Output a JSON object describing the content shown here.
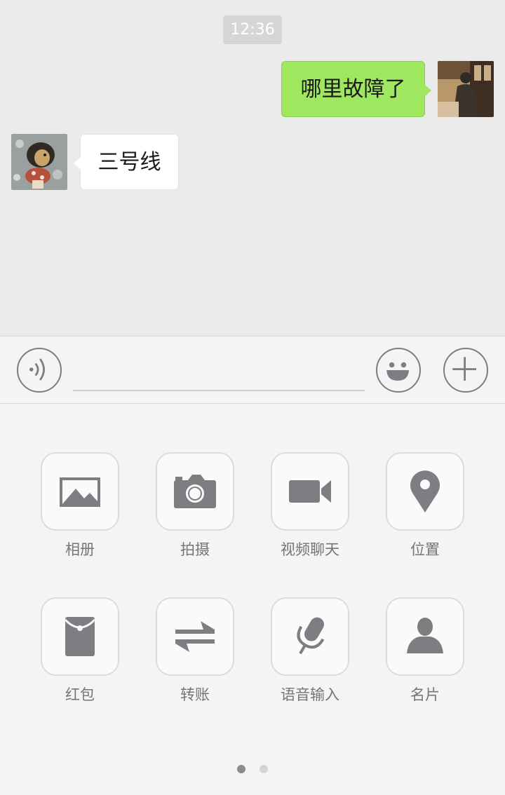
{
  "chat": {
    "timestamp": "12:36",
    "messages": [
      {
        "side": "right",
        "text": "哪里故障了"
      },
      {
        "side": "left",
        "text": "三号线"
      }
    ]
  },
  "input_bar": {
    "icons": [
      "voice-icon",
      "emoji-icon",
      "plus-icon"
    ],
    "text_value": ""
  },
  "panel": {
    "items": [
      {
        "label": "相册",
        "icon": "photo-album-icon"
      },
      {
        "label": "拍摄",
        "icon": "camera-icon"
      },
      {
        "label": "视频聊天",
        "icon": "video-call-icon"
      },
      {
        "label": "位置",
        "icon": "location-pin-icon"
      },
      {
        "label": "红包",
        "icon": "red-packet-icon"
      },
      {
        "label": "转账",
        "icon": "transfer-icon"
      },
      {
        "label": "语音输入",
        "icon": "microphone-icon"
      },
      {
        "label": "名片",
        "icon": "contact-card-icon"
      }
    ],
    "page_indicator": {
      "current": 1,
      "total": 2
    }
  },
  "colors": {
    "chat_background": "#ebebeb",
    "sent_bubble": "#9ee75e",
    "received_bubble": "#ffffff",
    "panel_background": "#f4f4f6",
    "icon_gray": "#7c7e81"
  }
}
